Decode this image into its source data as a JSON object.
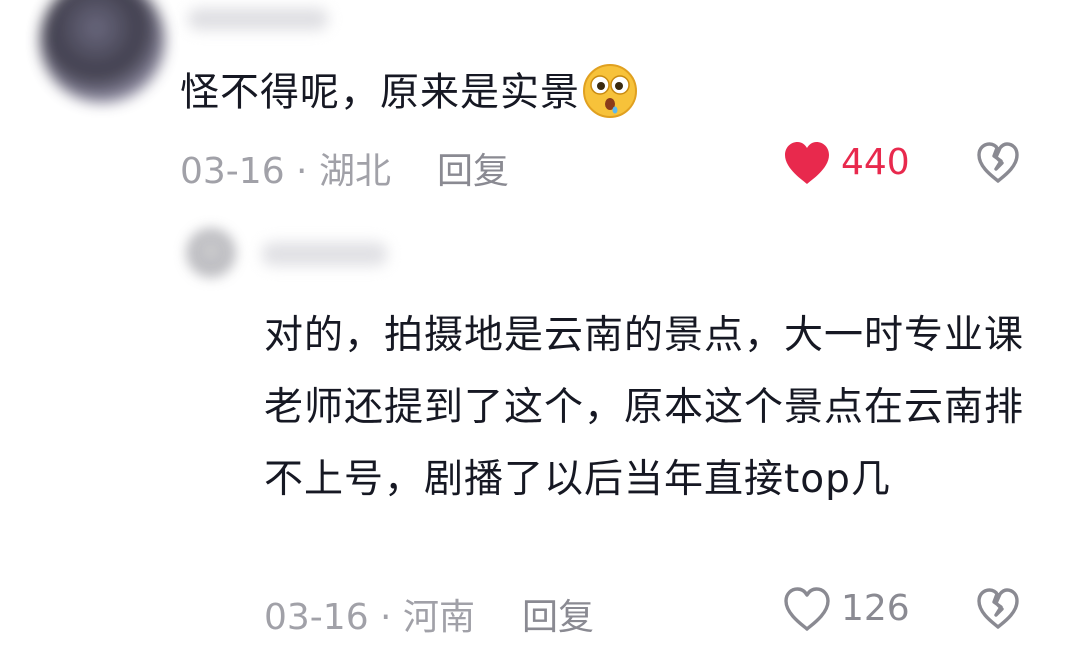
{
  "comment": {
    "text": "怪不得呢，原来是实景",
    "emoji": "face-with-open-mouth-emoji",
    "date_location": "03-16 · 湖北",
    "reply_label": "回复",
    "like_count": "440",
    "liked": true
  },
  "reply": {
    "text": "对的，拍摄地是云南的景点，大一时专业课老师还提到了这个，原本这个景点在云南排不上号，剧播了以后当年直接top几",
    "date_location": "03-16 · 河南",
    "reply_label": "回复",
    "like_count": "126",
    "liked": false
  },
  "colors": {
    "liked_heart": "#e8294d",
    "meta_text": "#a1a1a8",
    "body_text": "#161823"
  }
}
